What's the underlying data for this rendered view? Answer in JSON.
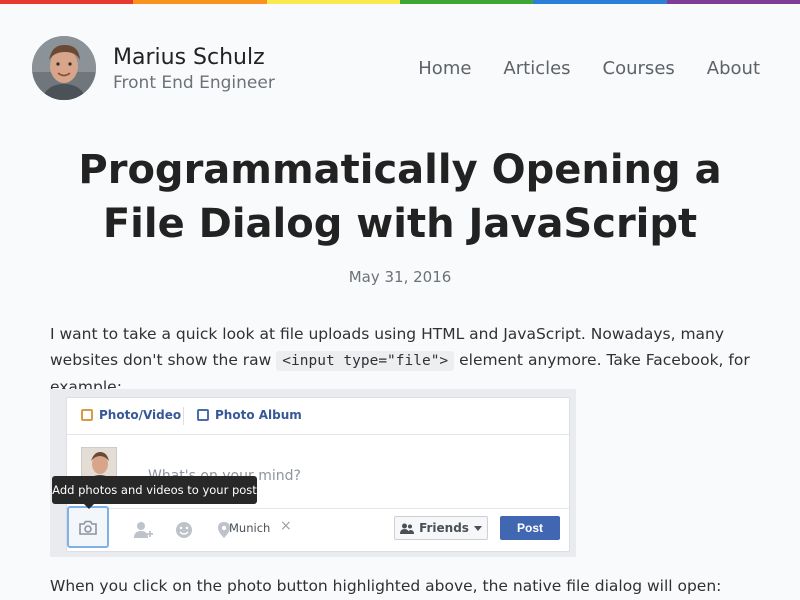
{
  "rainbow_colors": [
    "#e7392f",
    "#f7931e",
    "#fce94f",
    "#3fa535",
    "#2c7fd6",
    "#7f3b97"
  ],
  "header": {
    "name": "Marius Schulz",
    "tagline": "Front End Engineer",
    "nav": [
      "Home",
      "Articles",
      "Courses",
      "About"
    ]
  },
  "post": {
    "title": "Programmatically Opening a File Dialog with JavaScript",
    "date": "May 31, 2016",
    "para1_before": "I want to take a quick look at file uploads using HTML and JavaScript. Nowadays, many websites don't show the raw ",
    "para1_code": "<input type=\"file\">",
    "para1_after": " element anymore. Take Facebook, for example:",
    "para2": "When you click on the photo button highlighted above, the native file dialog will open:"
  },
  "fb": {
    "tab_photo": "Photo/Video",
    "tab_album": "Photo Album",
    "placeholder": "What's on your mind?",
    "tooltip": "Add photos and videos to your post",
    "location": "Munich",
    "location_clear": "×",
    "friends": "Friends",
    "post": "Post"
  }
}
